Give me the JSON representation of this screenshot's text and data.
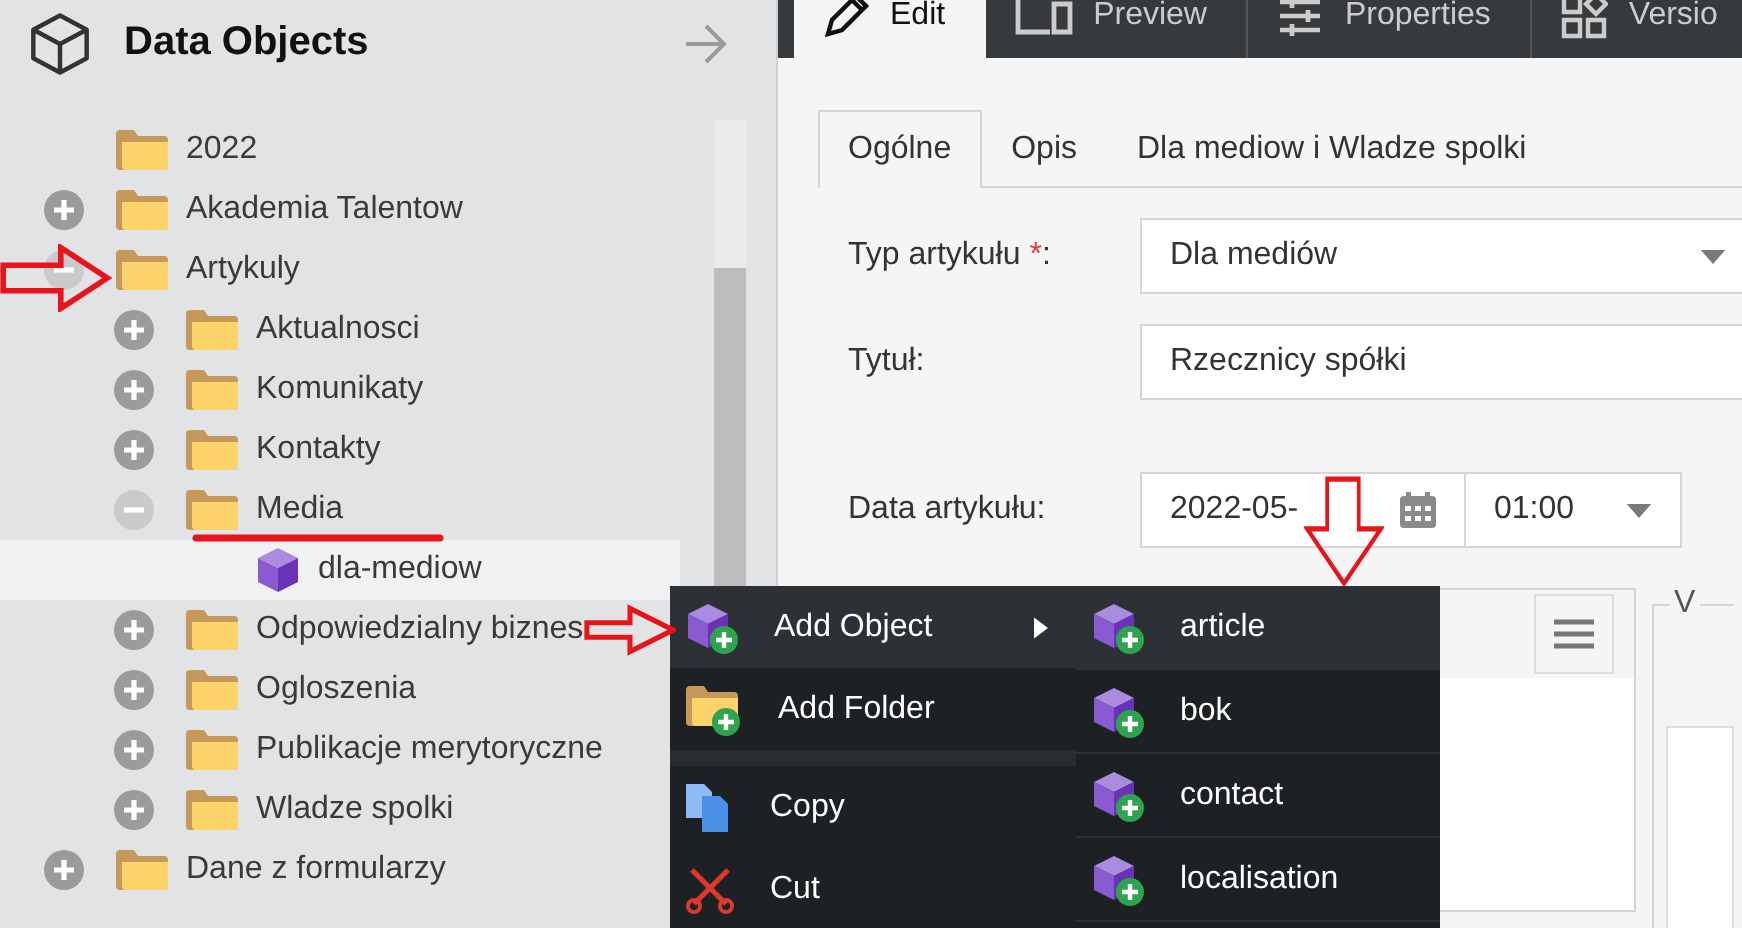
{
  "sidebar": {
    "title": "Data Objects",
    "tree": [
      {
        "label": "2022",
        "kind": "folder",
        "selected": false
      },
      {
        "label": "Akademia Talentow",
        "kind": "folder",
        "expanded": false,
        "selected": false
      },
      {
        "label": "Artykuly",
        "kind": "folder",
        "expanded": true,
        "selected": false,
        "children": [
          {
            "label": "Aktualnosci",
            "kind": "folder",
            "expanded": false,
            "selected": false
          },
          {
            "label": "Komunikaty",
            "kind": "folder",
            "expanded": false,
            "selected": false
          },
          {
            "label": "Kontakty",
            "kind": "folder",
            "expanded": false,
            "selected": false
          },
          {
            "label": "Media",
            "kind": "folder",
            "expanded": true,
            "selected": false,
            "children": [
              {
                "label": "dla-mediow",
                "kind": "object",
                "selected": true
              }
            ]
          },
          {
            "label": "Odpowiedzialny biznes",
            "kind": "folder",
            "expanded": false,
            "selected": false
          },
          {
            "label": "Ogloszenia",
            "kind": "folder",
            "expanded": false,
            "selected": false
          },
          {
            "label": "Publikacje merytoryczne",
            "kind": "folder",
            "expanded": false,
            "selected": false
          },
          {
            "label": "Wladze spolki",
            "kind": "folder",
            "expanded": false,
            "selected": false
          }
        ]
      },
      {
        "label": "Dane z formularzy",
        "kind": "folder",
        "expanded": false,
        "selected": false
      }
    ]
  },
  "toolbar_tabs": [
    {
      "label": "Edit",
      "kind": "edit",
      "selected": true
    },
    {
      "label": "Preview",
      "kind": "preview",
      "selected": false
    },
    {
      "label": "Properties",
      "kind": "properties",
      "selected": false
    },
    {
      "label": "Versio",
      "kind": "versions",
      "selected": false
    }
  ],
  "form_tabs": [
    {
      "label": "Ogólne",
      "selected": true
    },
    {
      "label": "Opis",
      "selected": false
    },
    {
      "label": "Dla mediow i Wladze spolki",
      "selected": false
    }
  ],
  "form": {
    "type": {
      "label": "Typ artykułu",
      "required_mark": "*",
      "colon": ":",
      "value": "Dla mediów"
    },
    "title": {
      "label": "Tytuł:",
      "value": "Rzecznicy spółki"
    },
    "date": {
      "label": "Data artykułu:",
      "value": "2022-05-",
      "time": "01:00"
    },
    "fieldset_legend": "V"
  },
  "context_menu": {
    "items": [
      {
        "label": "Add Object",
        "kind": "object",
        "submenu": true,
        "selected": true
      },
      {
        "label": "Add Folder",
        "kind": "folder",
        "submenu": false,
        "selected": false
      },
      {
        "kind": "divider"
      },
      {
        "label": "Copy",
        "kind": "copy",
        "submenu": false,
        "selected": false
      },
      {
        "label": "Cut",
        "kind": "cut",
        "submenu": false,
        "selected": false
      }
    ],
    "submenu": [
      {
        "label": "article",
        "selected": true
      },
      {
        "label": "bok",
        "selected": false
      },
      {
        "label": "contact",
        "selected": false
      },
      {
        "label": "localisation",
        "selected": false
      }
    ]
  }
}
